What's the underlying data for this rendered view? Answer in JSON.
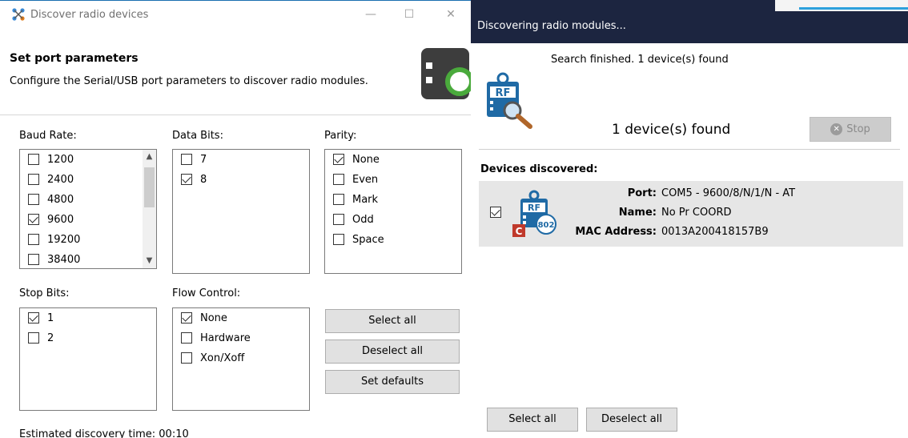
{
  "left_window": {
    "title": "Discover radio devices",
    "minimize": "—",
    "maximize": "☐",
    "close": "✕",
    "header_title": "Set port parameters",
    "header_desc": "Configure the Serial/USB port parameters to discover radio modules.",
    "baud_rate": {
      "label": "Baud Rate:",
      "items": [
        {
          "label": "1200",
          "checked": false
        },
        {
          "label": "2400",
          "checked": false
        },
        {
          "label": "4800",
          "checked": false
        },
        {
          "label": "9600",
          "checked": true
        },
        {
          "label": "19200",
          "checked": false
        },
        {
          "label": "38400",
          "checked": false
        }
      ]
    },
    "data_bits": {
      "label": "Data Bits:",
      "items": [
        {
          "label": "7",
          "checked": false
        },
        {
          "label": "8",
          "checked": true
        }
      ]
    },
    "parity": {
      "label": "Parity:",
      "items": [
        {
          "label": "None",
          "checked": true
        },
        {
          "label": "Even",
          "checked": false
        },
        {
          "label": "Mark",
          "checked": false
        },
        {
          "label": "Odd",
          "checked": false
        },
        {
          "label": "Space",
          "checked": false
        }
      ]
    },
    "stop_bits": {
      "label": "Stop Bits:",
      "items": [
        {
          "label": "1",
          "checked": true
        },
        {
          "label": "2",
          "checked": false
        }
      ]
    },
    "flow_control": {
      "label": "Flow Control:",
      "items": [
        {
          "label": "None",
          "checked": true
        },
        {
          "label": "Hardware",
          "checked": false
        },
        {
          "label": "Xon/Xoff",
          "checked": false
        }
      ]
    },
    "buttons": {
      "select_all": "Select all",
      "deselect_all": "Deselect all",
      "set_defaults": "Set defaults"
    },
    "footer": "Estimated discovery time: 00:10"
  },
  "right_window": {
    "title": "Discovering radio modules...",
    "search_status": "Search finished. 1 device(s) found",
    "found_count": "1 device(s) found",
    "stop_label": "Stop",
    "devices_heading": "Devices discovered:",
    "device": {
      "checked": true,
      "icon_badge": "C",
      "icon_protocol": "802",
      "icon_text": "RF",
      "port_key": "Port:",
      "port_value": "COM5 - 9600/8/N/1/N - AT",
      "name_key": "Name:",
      "name_value": "No Pr COORD",
      "mac_key": "MAC Address:",
      "mac_value": "0013A200418157B9"
    },
    "select_all": "Select all",
    "deselect_all": "Deselect all"
  },
  "colors": {
    "dark_titlebar": "#1c2540",
    "accent_blue": "#2ca0dc",
    "device_row_bg": "#e6e6e6",
    "rf_icon_blue": "#1f6aa5",
    "badge_red": "#c0392b"
  }
}
